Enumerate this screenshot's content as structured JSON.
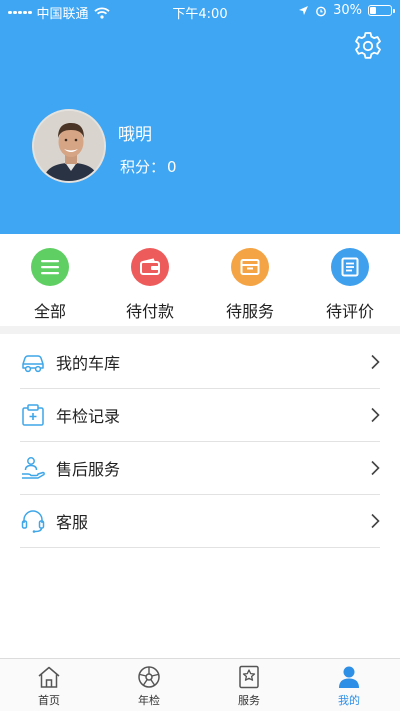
{
  "status_bar": {
    "carrier": "中国联通",
    "time": "下午4:00",
    "battery": "30%"
  },
  "profile": {
    "name": "哦明",
    "points_label": "积分：",
    "points_value": "0"
  },
  "orders": [
    {
      "label": "全部",
      "icon": "list-icon",
      "color": "#5fcf63"
    },
    {
      "label": "待付款",
      "icon": "wallet-icon",
      "color": "#ee5b5b"
    },
    {
      "label": "待服务",
      "icon": "box-icon",
      "color": "#f4a445"
    },
    {
      "label": "待评价",
      "icon": "document-icon",
      "color": "#3fa0ee"
    }
  ],
  "menu": [
    {
      "label": "我的车库",
      "icon": "car-icon"
    },
    {
      "label": "年检记录",
      "icon": "inspection-icon"
    },
    {
      "label": "售后服务",
      "icon": "service-hand-icon"
    },
    {
      "label": "客服",
      "icon": "headset-icon"
    }
  ],
  "tabs": [
    {
      "label": "首页",
      "icon": "home-icon"
    },
    {
      "label": "年检",
      "icon": "wheel-icon"
    },
    {
      "label": "服务",
      "icon": "star-badge-icon"
    },
    {
      "label": "我的",
      "icon": "person-icon"
    }
  ],
  "colors": {
    "header_bg": "#3fa6f3",
    "active_tab": "#2d8fe6",
    "menu_icon": "#3fa6e8"
  }
}
